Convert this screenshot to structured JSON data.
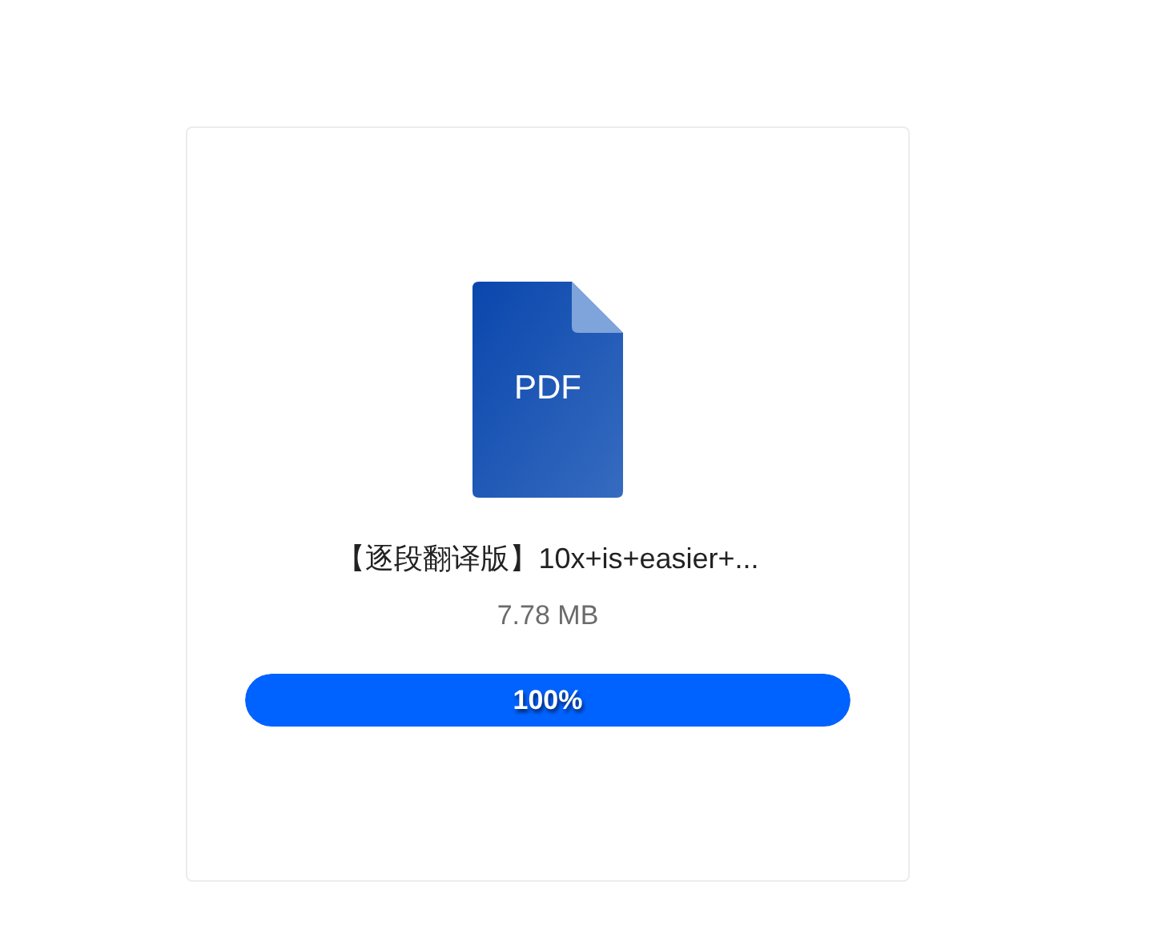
{
  "file": {
    "type_label": "PDF",
    "name": "【逐段翻译版】10x+is+easier+...",
    "size": "7.78 MB"
  },
  "upload": {
    "level": 1,
    "reading": "100%"
  }
}
